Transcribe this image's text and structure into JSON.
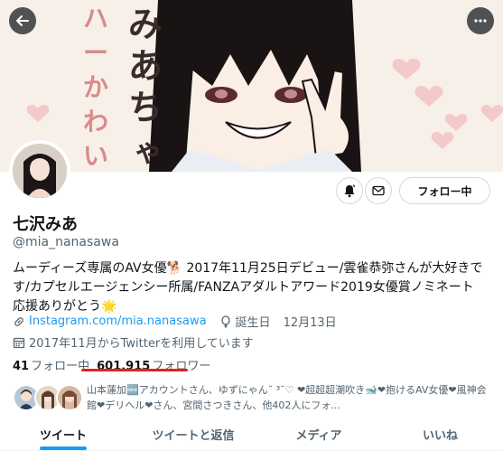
{
  "profile": {
    "name": "七沢みあ",
    "handle": "@mia_nanasawa",
    "bio": "ムーディーズ専属のAV女優🐕 2017年11月25日デビュー/雲雀恭弥さんが大好きです/カプセルエージェンシー所属/FANZAアダルトアワード2019女優賞ノミネート 応援ありがとう🌟",
    "link": "Instagram.com/mia.nanasawa",
    "birthday_label": "誕生日",
    "birthday": "12月13日",
    "joined": "2017年11月からTwitterを利用しています"
  },
  "counts": {
    "following_value": "41",
    "following_label": "フォロー中",
    "followers_value": "601,915",
    "followers_label": "フォロワー"
  },
  "known_followers": {
    "text": "山本蓮加🆕アカウントさん、ゆずにゃん˘ ³˘♡ ❤超超超潮吹き🐋❤抱けるAV女優❤風神会館❤デリヘル❤さん、宮間さつきさん、他402人にフォ..."
  },
  "actions": {
    "follow_label": "フォロー中"
  },
  "tabs": [
    {
      "label": "ツイート",
      "active": true
    },
    {
      "label": "ツイートと返信",
      "active": false
    },
    {
      "label": "メディア",
      "active": false
    },
    {
      "label": "いいね",
      "active": false
    }
  ],
  "banner": {
    "text": "みあちゃんハーかわいい"
  },
  "colors": {
    "accent": "#1d9bf0",
    "underline": "#e0241b",
    "muted": "#536471"
  },
  "icons": {
    "back": "arrow-left-icon",
    "more": "more-icon",
    "bell": "bell-icon",
    "mail": "mail-icon",
    "link": "link-icon",
    "balloon": "balloon-icon",
    "calendar": "calendar-icon"
  }
}
